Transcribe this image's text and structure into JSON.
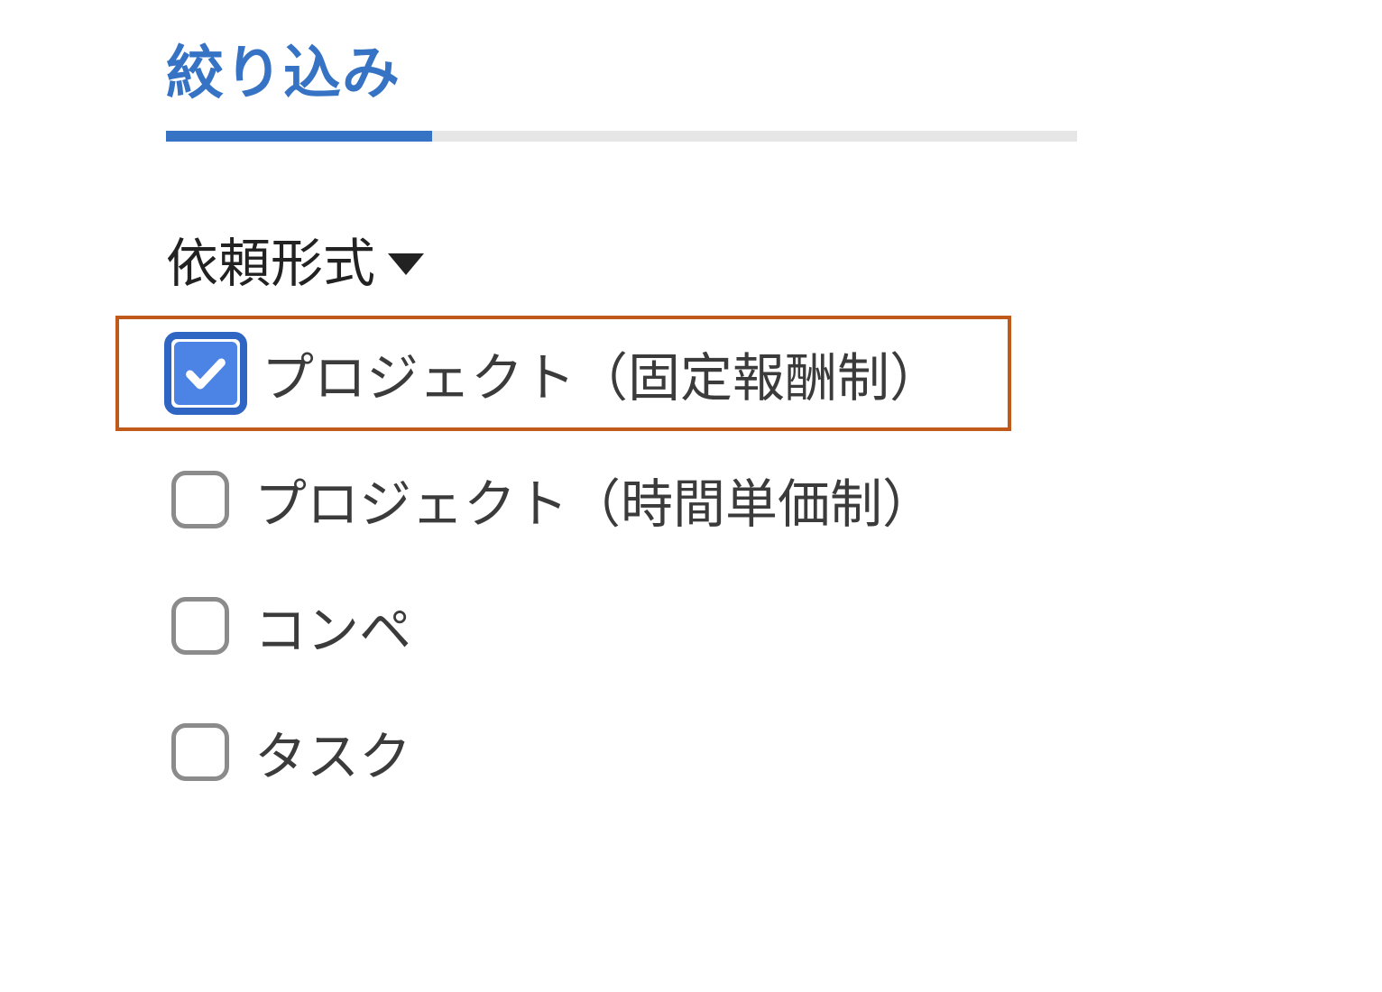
{
  "tabs": {
    "active_label": "絞り込み"
  },
  "filter_section": {
    "title": "依頼形式",
    "options": [
      {
        "label": "プロジェクト（固定報酬制）",
        "checked": true,
        "highlight": true
      },
      {
        "label": "プロジェクト（時間単価制）",
        "checked": false,
        "highlight": false
      },
      {
        "label": "コンペ",
        "checked": false,
        "highlight": false
      },
      {
        "label": "タスク",
        "checked": false,
        "highlight": false
      }
    ]
  }
}
